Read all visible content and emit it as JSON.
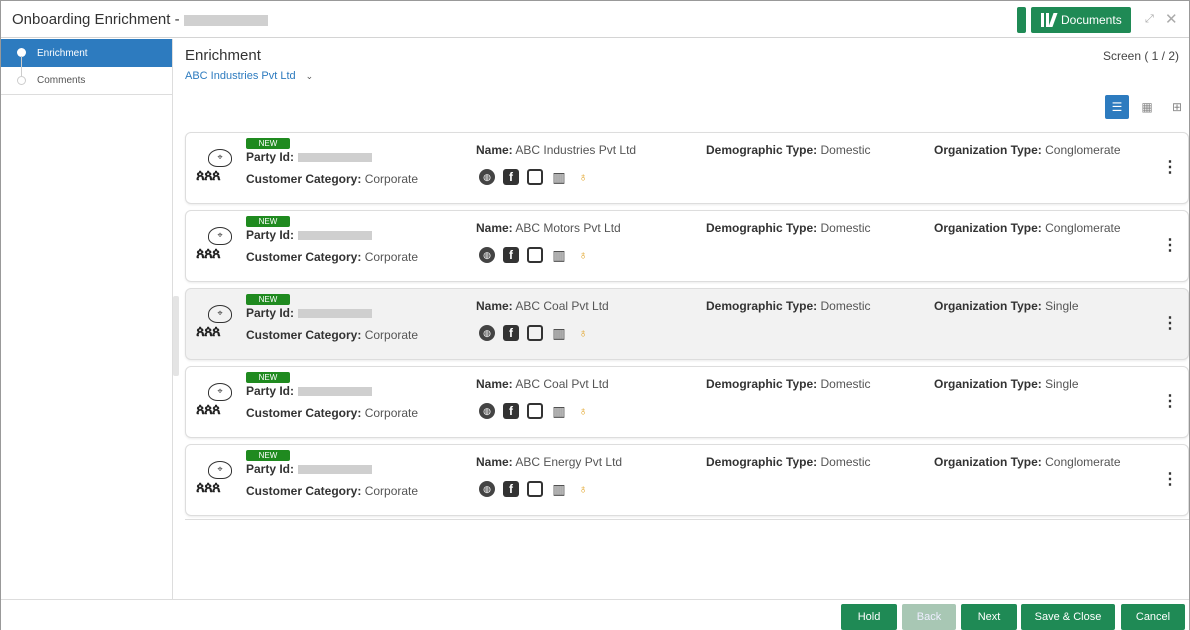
{
  "window": {
    "title": "Onboarding Enrichment -",
    "documents_label": "Documents",
    "minimize_glyph": "⤢",
    "close_glyph": "✕"
  },
  "sidebar": {
    "items": [
      {
        "label": "Enrichment",
        "active": true
      },
      {
        "label": "Comments",
        "active": false
      }
    ]
  },
  "main": {
    "title": "Enrichment",
    "subtitle": "ABC Industries Pvt Ltd",
    "subtitle_chevron": "⌄",
    "screen_count": "Screen ( 1 / 2)",
    "view_toggle": [
      {
        "icon": "list-view-icon",
        "glyph": "☰",
        "active": true
      },
      {
        "icon": "grid-view-icon",
        "glyph": "▦",
        "active": false
      },
      {
        "icon": "tree-view-icon",
        "glyph": "⊞",
        "active": false
      }
    ]
  },
  "labels": {
    "new_badge": "NEW",
    "party_id": "Party Id:",
    "customer_category": "Customer Category:",
    "name": "Name:",
    "demographic_type": "Demographic Type:",
    "organization_type": "Organization Type:"
  },
  "cards": [
    {
      "customer_category": "Corporate",
      "name": "ABC Industries Pvt Ltd",
      "demographic_type": "Domestic",
      "organization_type": "Conglomerate"
    },
    {
      "customer_category": "Corporate",
      "name": "ABC Motors Pvt Ltd",
      "demographic_type": "Domestic",
      "organization_type": "Conglomerate"
    },
    {
      "customer_category": "Corporate",
      "name": "ABC Coal Pvt Ltd",
      "demographic_type": "Domestic",
      "organization_type": "Single"
    },
    {
      "customer_category": "Corporate",
      "name": "ABC Coal Pvt Ltd",
      "demographic_type": "Domestic",
      "organization_type": "Single"
    },
    {
      "customer_category": "Corporate",
      "name": "ABC Energy Pvt Ltd",
      "demographic_type": "Domestic",
      "organization_type": "Conglomerate"
    }
  ],
  "footer": {
    "hold": "Hold",
    "back": "Back",
    "next": "Next",
    "save_close": "Save & Close",
    "cancel": "Cancel"
  },
  "colors": {
    "accent_blue": "#2d7bbf",
    "brand_green": "#1f8a55",
    "badge_green": "#1f8a1f"
  }
}
